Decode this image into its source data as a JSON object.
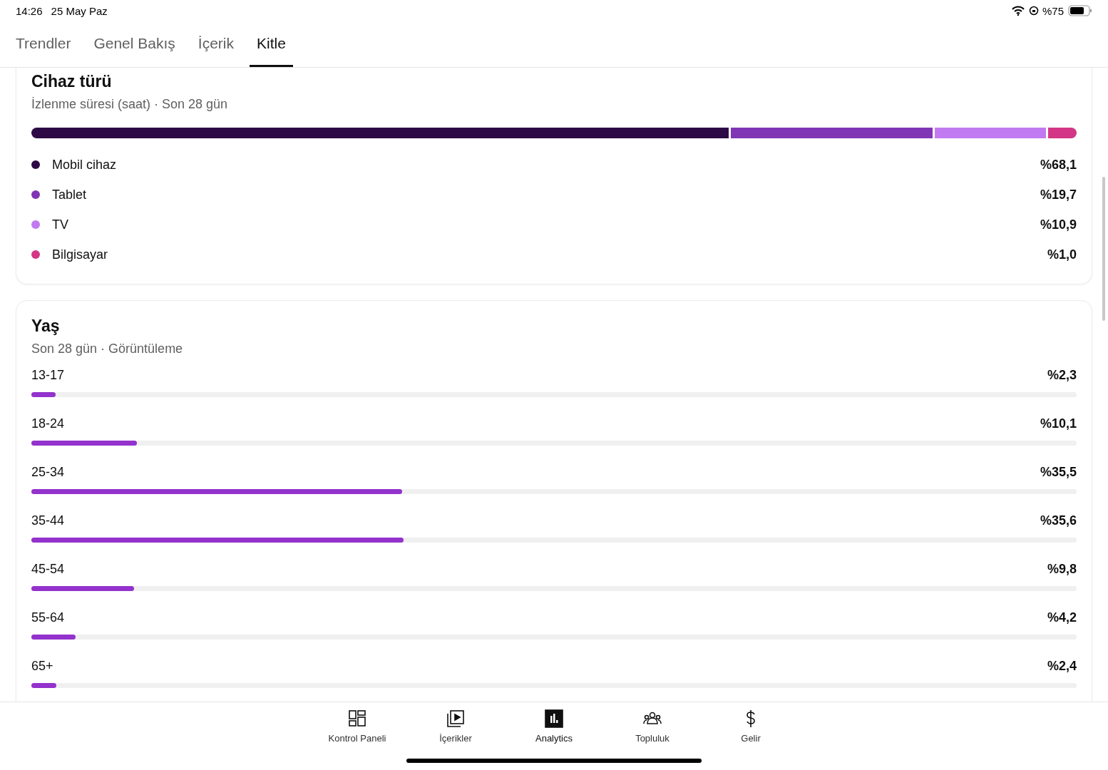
{
  "status_bar": {
    "time": "14:26",
    "date": "25 May Paz",
    "battery": "%75"
  },
  "tabs": [
    {
      "label": "Trendler",
      "selected": false
    },
    {
      "label": "Genel Bakış",
      "selected": false
    },
    {
      "label": "İçerik",
      "selected": false
    },
    {
      "label": "Kitle",
      "selected": true
    }
  ],
  "device_card": {
    "title": "Cihaz türü",
    "subtitle": "İzlenme süresi (saat) · Son 28 gün",
    "items": [
      {
        "label": "Mobil cihaz",
        "value": "%68,1",
        "color": "#2d0a45"
      },
      {
        "label": "Tablet",
        "value": "%19,7",
        "color": "#8035b5"
      },
      {
        "label": "TV",
        "value": "%10,9",
        "color": "#c27af2"
      },
      {
        "label": "Bilgisayar",
        "value": "%1,0",
        "color": "#d33685"
      }
    ]
  },
  "age_card": {
    "title": "Yaş",
    "subtitle": "Son 28 gün · Görüntüleme",
    "rows": [
      {
        "label": "13-17",
        "value": "%2,3",
        "level": 0.023
      },
      {
        "label": "18-24",
        "value": "%10,1",
        "level": 0.101
      },
      {
        "label": "25-34",
        "value": "%35,5",
        "level": 0.355
      },
      {
        "label": "35-44",
        "value": "%35,6",
        "level": 0.356
      },
      {
        "label": "45-54",
        "value": "%9,8",
        "level": 0.098
      },
      {
        "label": "55-64",
        "value": "%4,2",
        "level": 0.042
      },
      {
        "label": "65+",
        "value": "%2,4",
        "level": 0.024
      }
    ]
  },
  "bottom_nav": [
    {
      "label": "Kontrol Paneli",
      "kind": "dashboard",
      "selected": false
    },
    {
      "label": "İçerikler",
      "kind": "content",
      "selected": false
    },
    {
      "label": "Analytics",
      "kind": "analytics",
      "selected": true
    },
    {
      "label": "Topluluk",
      "kind": "community",
      "selected": false
    },
    {
      "label": "Gelir",
      "kind": "earn",
      "selected": false
    }
  ]
}
